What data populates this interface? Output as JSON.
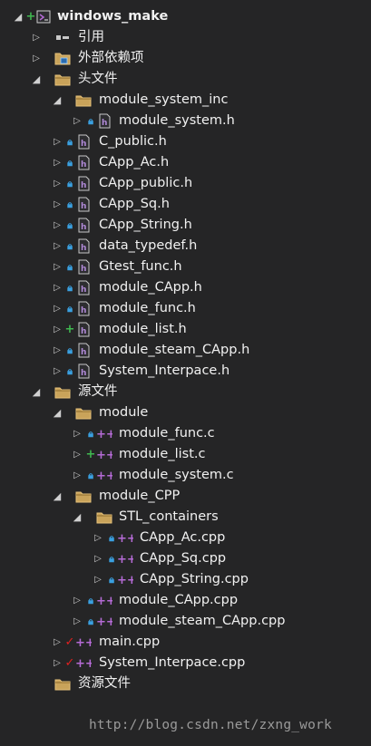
{
  "solution": {
    "name": "windows_make"
  },
  "tree": {
    "references": "引用",
    "external_deps": "外部依赖项",
    "header_files": "头文件",
    "module_system_inc": "module_system_inc",
    "module_system_h": "module_system.h",
    "c_public_h": "C_public.h",
    "capp_ac_h": "CApp_Ac.h",
    "capp_public_h": "CApp_public.h",
    "capp_sq_h": "CApp_Sq.h",
    "capp_string_h": "CApp_String.h",
    "data_typedef_h": "data_typedef.h",
    "gtest_func_h": "Gtest_func.h",
    "module_capp_h": "module_CApp.h",
    "module_func_h": "module_func.h",
    "module_list_h": "module_list.h",
    "module_steam_capp_h": "module_steam_CApp.h",
    "system_interpace_h": "System_Interpace.h",
    "source_files": "源文件",
    "module_folder": "module",
    "module_func_c": "module_func.c",
    "module_list_c": "module_list.c",
    "module_system_c": "module_system.c",
    "module_cpp_folder": "module_CPP",
    "stl_containers": "STL_containers",
    "capp_ac_cpp": "CApp_Ac.cpp",
    "capp_sq_cpp": "CApp_Sq.cpp",
    "capp_string_cpp": "CApp_String.cpp",
    "module_capp_cpp": "module_CApp.cpp",
    "module_steam_capp_cpp": "module_steam_CApp.cpp",
    "main_cpp": "main.cpp",
    "system_interpace_cpp": "System_Interpace.cpp",
    "resource_files": "资源文件"
  },
  "watermark": "http://blog.csdn.net/zxng_work",
  "colors": {
    "background": "#252526",
    "text": "#f1f1f1",
    "folder": "#d8b26a",
    "header_icon": "#b18ad8",
    "source_icon": "#b56bd6",
    "lock": "#3aa0e0",
    "add": "#3fb950",
    "edit": "#e02020"
  }
}
